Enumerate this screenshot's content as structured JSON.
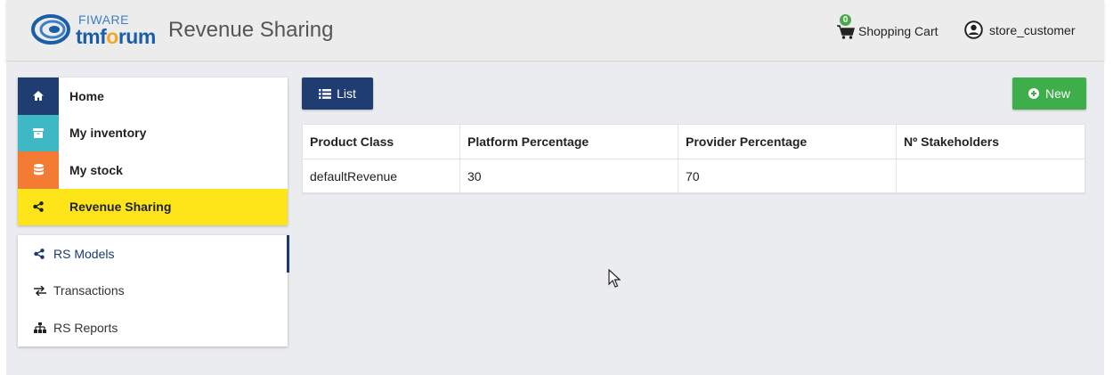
{
  "header": {
    "logo_top": "FIWARE",
    "logo_bottom_a": "tmf",
    "logo_bottom_b": "o",
    "logo_bottom_c": "rum",
    "title": "Revenue Sharing",
    "cart_label": "Shopping Cart",
    "cart_count": "0",
    "user_label": "store_customer",
    "cart_icon": "shopping-cart-icon",
    "user_icon": "user-circle-icon"
  },
  "nav": {
    "items": [
      {
        "label": "Home",
        "icon": "home-icon",
        "color": "#1f3d70"
      },
      {
        "label": "My inventory",
        "icon": "archive-icon",
        "color": "#3fb8c6"
      },
      {
        "label": "My stock",
        "icon": "database-icon",
        "color": "#f47b33"
      },
      {
        "label": "Revenue Sharing",
        "icon": "share-icon",
        "color": "#fde51a"
      }
    ]
  },
  "subnav": {
    "items": [
      {
        "label": "RS Models",
        "icon": "share-icon"
      },
      {
        "label": "Transactions",
        "icon": "exchange-icon"
      },
      {
        "label": "RS Reports",
        "icon": "sitemap-icon"
      }
    ]
  },
  "toolbar": {
    "list_label": "List",
    "new_label": "New"
  },
  "table": {
    "headers": [
      "Product Class",
      "Platform Percentage",
      "Provider Percentage",
      "Nº Stakeholders"
    ],
    "rows": [
      [
        "defaultRevenue",
        "30",
        "70",
        ""
      ]
    ]
  },
  "colors": {
    "primary": "#1f3d70",
    "success": "#3dae4a",
    "active": "#fde51a"
  }
}
